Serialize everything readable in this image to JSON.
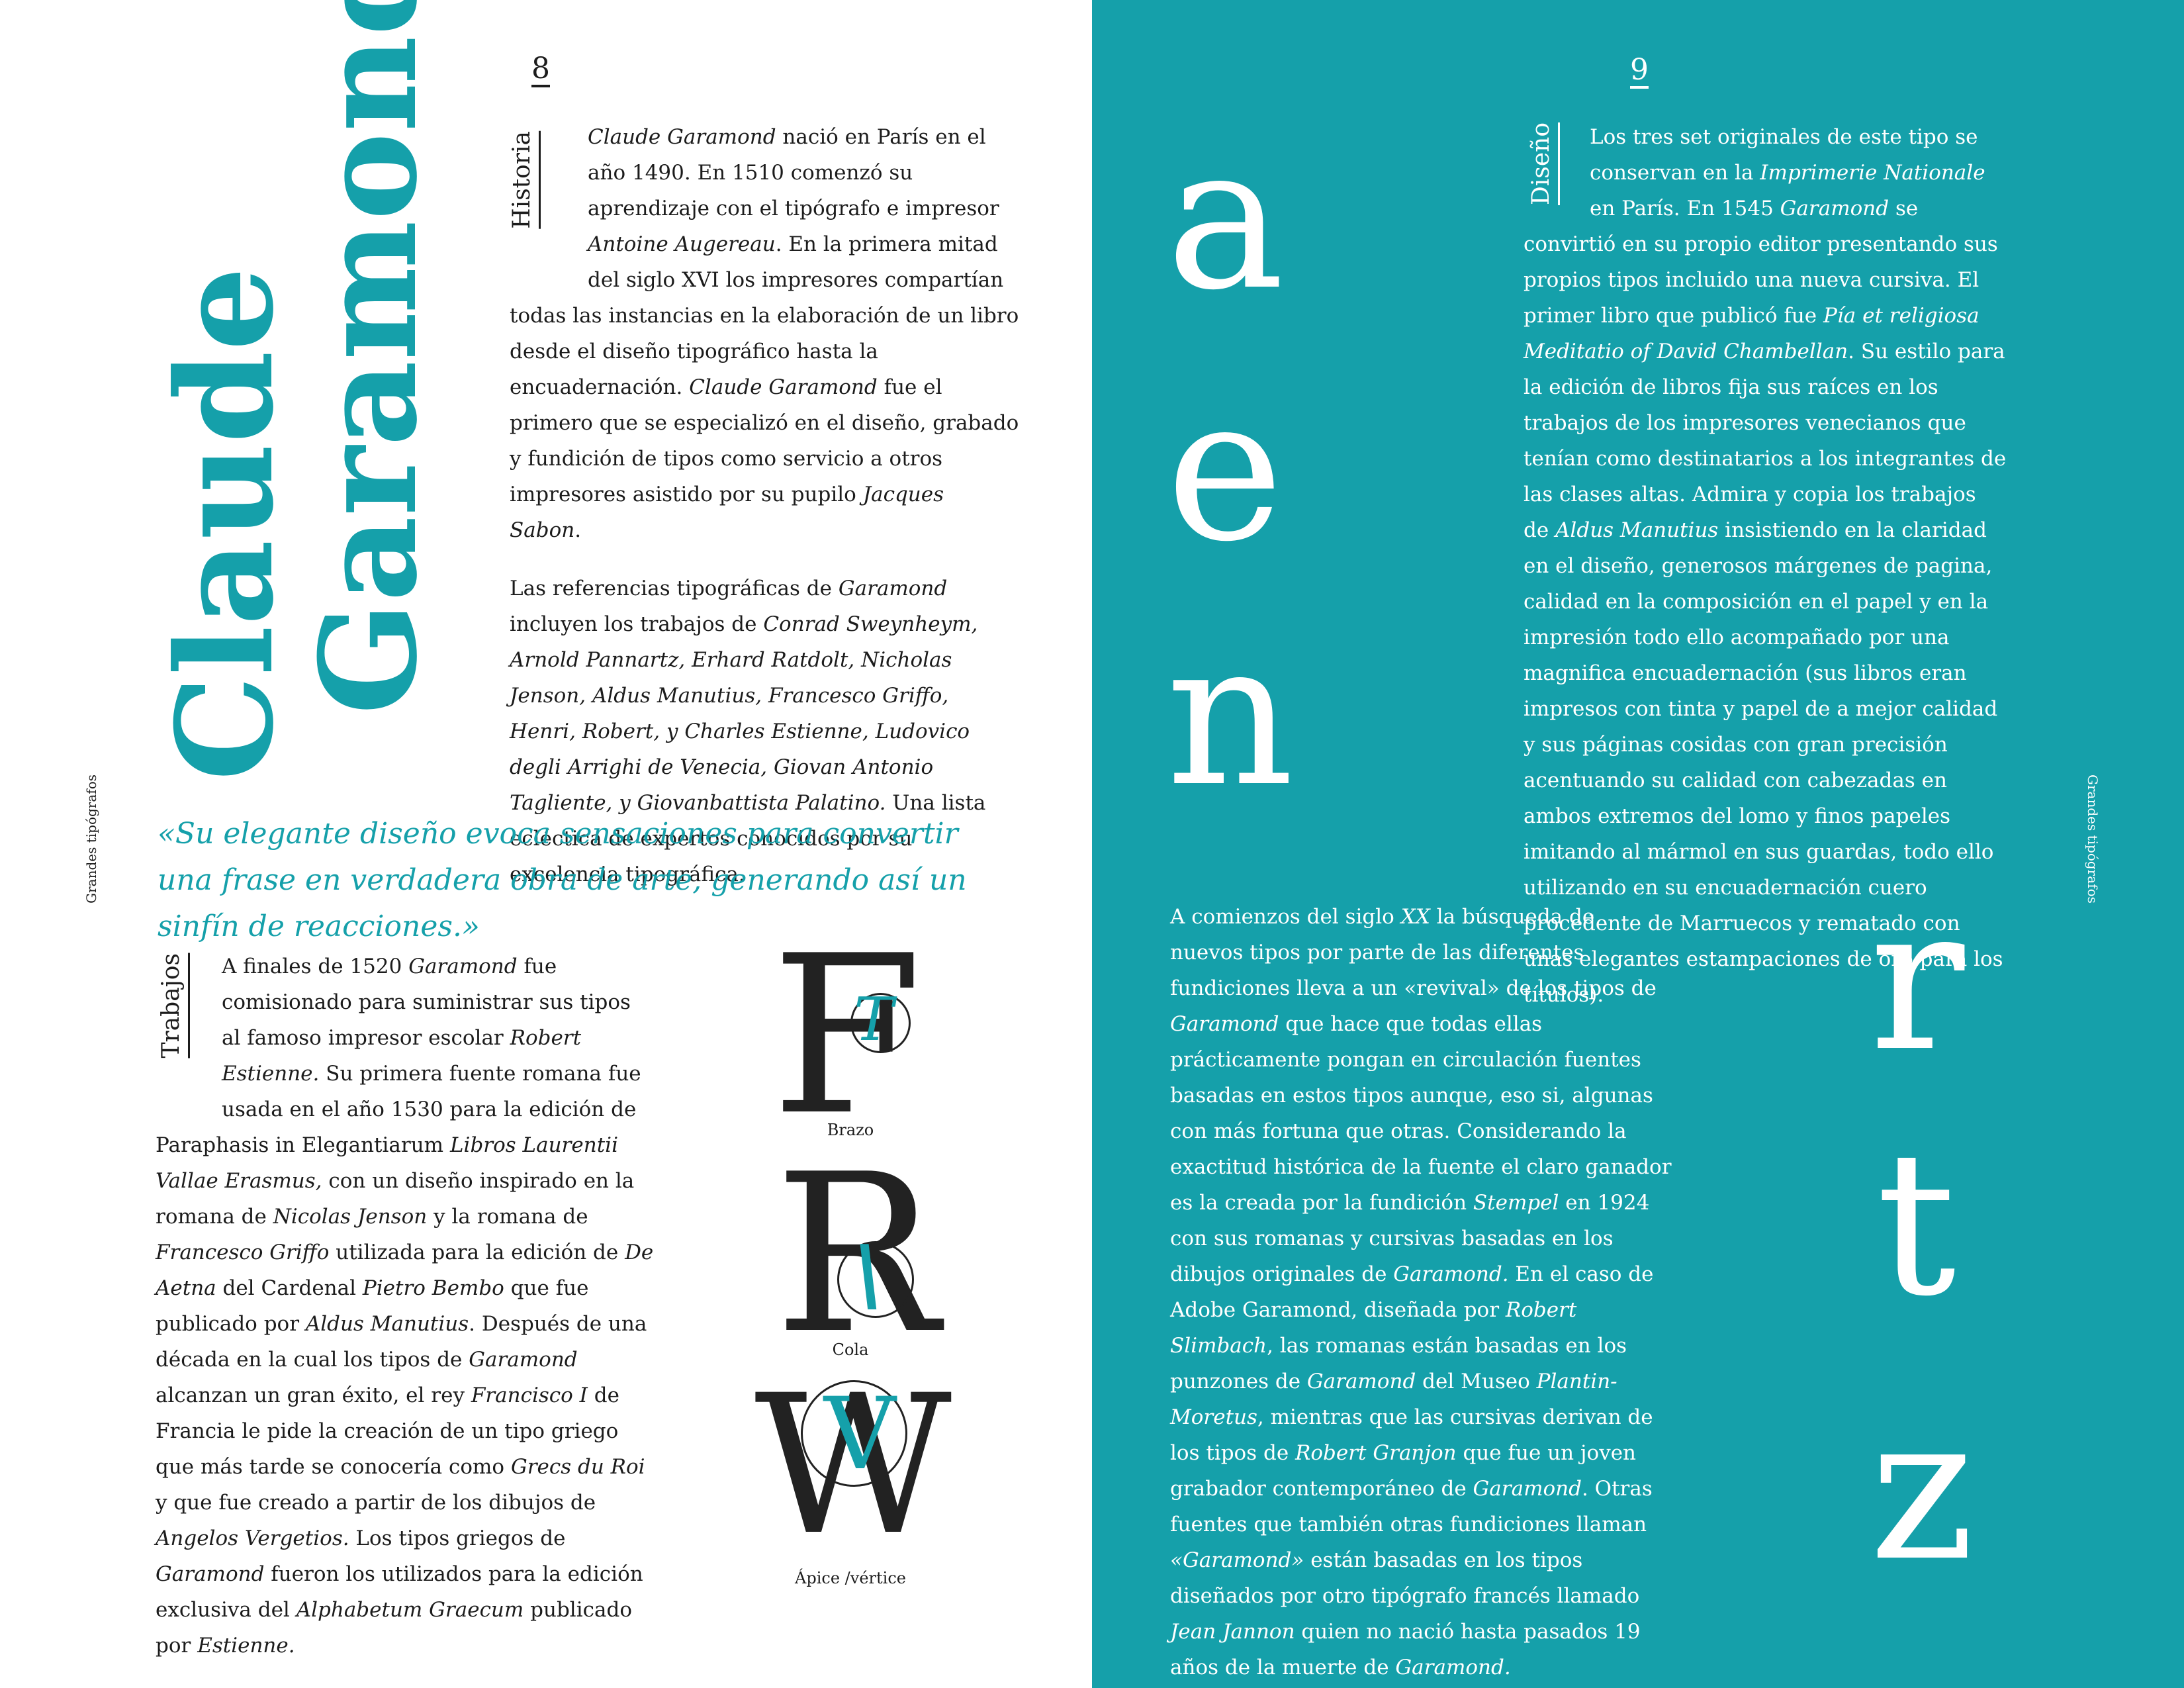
{
  "left_page": {
    "page_number": "8",
    "running_head": "Grandes tipógrafos",
    "title_line1": "Claude",
    "title_line2": "Garamond",
    "historia": {
      "label": "Historia",
      "p1": [
        {
          "i": "Claude Garamond"
        },
        {
          "t": " nació en París en el año 1490. En 1510 comenzó su aprendizaje con el tipógrafo e impresor "
        },
        {
          "i": "Antoine Augereau"
        },
        {
          "t": ". En la primera mitad del siglo XVI los impresores compartían todas las instancias en la elaboración de un libro desde el diseño tipográfico hasta la encuadernación. "
        },
        {
          "i": "Claude Garamond"
        },
        {
          "t": " fue el primero que se especializó en el diseño, grabado y fundición de tipos como servicio a otros impresores asistido por su pupilo "
        },
        {
          "i": "Jacques Sabon"
        },
        {
          "t": "."
        }
      ],
      "p2": [
        {
          "t": "Las referencias tipográficas de "
        },
        {
          "i": "Garamond"
        },
        {
          "t": " incluyen los trabajos de "
        },
        {
          "i": "Conrad Sweynheym, Arnold  Pannartz, Erhard Ratdolt, Nicholas Jenson, Aldus Manutius, Francesco Griffo, Henri, Robert, y Charles Estienne, Ludovico degli Arrighi de Venecia, Giovan Antonio Tagliente, y Giovanbattista Palatino."
        },
        {
          "t": " Una lista ecléctica de expertos conocidos por su excelencia tipográfica."
        }
      ]
    },
    "quote": "«Su elegante diseño evoca sensaciones para convertir una frase en verdadera obra de arte, generando así un sinfín de reacciones.»",
    "trabajos": {
      "label": "Trabajos",
      "p1": [
        {
          "t": "A finales de 1520 "
        },
        {
          "i": "Garamond"
        },
        {
          "t": " fue comisionado para suministrar sus tipos al famoso impresor escolar "
        },
        {
          "i": "Robert Estienne."
        },
        {
          "t": " Su primera fuente romana fue usada en el año 1530 para la edición de Paraphasis in Elegantiarum "
        },
        {
          "i": "Libros Laurentii Vallae Erasmus,"
        },
        {
          "t": " con un diseño inspirado en la romana de "
        },
        {
          "i": "Nicolas Jenson"
        },
        {
          "t": " y la romana de "
        },
        {
          "i": "Francesco Griffo"
        },
        {
          "t": " utilizada para la edición de "
        },
        {
          "i": "De Aetna"
        },
        {
          "t": " del Cardenal "
        },
        {
          "i": "Pietro Bembo"
        },
        {
          "t": " que fue publicado por "
        },
        {
          "i": "Aldus Manutius"
        },
        {
          "t": ". Después de una década en la cual los tipos de "
        },
        {
          "i": "Garamond"
        },
        {
          "t": " alcanzan un gran éxito, el rey "
        },
        {
          "i": "Francisco I"
        },
        {
          "t": " de Francia le pide la creación de un tipo griego que más tarde se conocería como "
        },
        {
          "i": "Grecs du Roi"
        },
        {
          "t": " y que fue creado a partir de los dibujos de "
        },
        {
          "i": "Angelos Vergetios."
        },
        {
          "t": " Los tipos griegos de "
        },
        {
          "i": "Garamond"
        },
        {
          "t": " fueron los utilizados para la edición exclusiva del "
        },
        {
          "i": "Alphabetum Graecum"
        },
        {
          "t": " publicado por "
        },
        {
          "i": "Estienne."
        }
      ]
    },
    "anatomy": [
      {
        "letter": "F",
        "detail": "T",
        "caption": "Brazo"
      },
      {
        "letter": "R",
        "detail": "\\",
        "caption": "Cola"
      },
      {
        "letter": "W",
        "detail": "V",
        "caption": "Ápice /vértice"
      }
    ]
  },
  "right_page": {
    "page_number": "9",
    "running_head": "Grandes tipógrafos",
    "big_letters_left": [
      "a",
      "e",
      "n"
    ],
    "big_letters_right": [
      "r",
      "t",
      "z"
    ],
    "diseno": {
      "label": "Diseño",
      "p1": [
        {
          "t": "Los tres set originales de este tipo se conservan en la "
        },
        {
          "i": "Imprimerie Nationale"
        },
        {
          "t": " en París. En 1545 "
        },
        {
          "i": "Garamond"
        },
        {
          "t": " se convirtió en su propio editor presentando sus propios tipos incluido una nueva cursiva. El primer libro que publicó fue "
        },
        {
          "i": "Pía et religiosa Meditatio of David Chambellan"
        },
        {
          "t": ". Su estilo para la edición de libros fija sus raíces en los trabajos de los impresores venecianos que tenían como destinatarios a los integrantes de las clases altas. Admira y copia los trabajos de "
        },
        {
          "i": "Aldus Manutius"
        },
        {
          "t": " insistiendo en la claridad en el diseño, generosos márgenes de pagina, calidad en la composición en el papel y en la impresión todo ello acompañado por una magnifica encuadernación  (sus libros eran impresos con tinta y papel de a mejor calidad y sus páginas cosidas con gran precisión acentuando su calidad con cabezadas en ambos extremos del lomo y finos papeles imitando al mármol en sus guardas, todo ello utilizando en su encuadernación cuero procedente de Marruecos y rematado con unas elegantes estampaciones de oro para los títulos)."
        }
      ]
    },
    "p2": [
      {
        "t": "A comienzos del siglo "
      },
      {
        "i": "XX"
      },
      {
        "t": " la búsqueda de nuevos tipos por parte de las diferentes fundiciones lleva a un «revival» de los tipos de "
      },
      {
        "i": "Garamond"
      },
      {
        "t": " que hace que todas ellas prácticamente pongan en circulación fuentes basadas en estos tipos aunque, eso si, algunas con más fortuna que otras. Considerando la exactitud histórica de la fuente el claro ganador es la creada por la fundición "
      },
      {
        "i": "Stempel"
      },
      {
        "t": " en 1924 con sus romanas y cursivas basadas en los dibujos originales de "
      },
      {
        "i": "Garamond."
      },
      {
        "t": " En el caso de Adobe Garamond, diseñada por "
      },
      {
        "i": "Robert Slimbach"
      },
      {
        "t": ", las romanas están basadas en los punzones de "
      },
      {
        "i": "Garamond"
      },
      {
        "t": " del Museo "
      },
      {
        "i": "Plantin-Moretus"
      },
      {
        "t": ", mientras que las cursivas derivan de los tipos de "
      },
      {
        "i": "Robert Granjon"
      },
      {
        "t": " que fue un joven grabador contemporáneo de "
      },
      {
        "i": "Garamond"
      },
      {
        "t": ". Otras fuentes que también otras fundiciones llaman "
      },
      {
        "i": "«Garamond»"
      },
      {
        "t": " están basadas en los tipos diseñados por otro tipógrafo francés llamado "
      },
      {
        "i": "Jean Jannon"
      },
      {
        "t": " quien no nació hasta pasados 19 años de la muerte de "
      },
      {
        "i": "Garamond."
      }
    ]
  },
  "colors": {
    "teal": "#15a0aa",
    "ink": "#1c1c1c",
    "white": "#ffffff"
  }
}
